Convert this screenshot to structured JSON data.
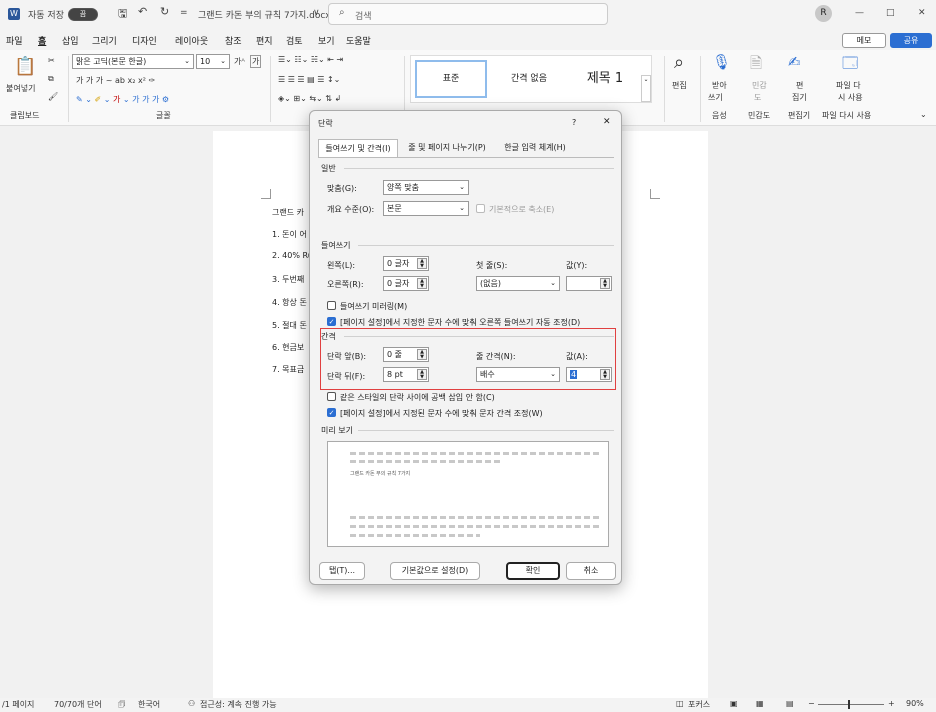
{
  "titlebar": {
    "autosave": "자동 저장",
    "toggle": "끔",
    "filename": "그랜드 카돈 부의 규칙 7가지.docx",
    "filename_chevron": "∨",
    "search": "검색",
    "avatar": "R"
  },
  "menu": [
    "파일",
    "홈",
    "삽입",
    "그리기",
    "디자인",
    "레이아웃",
    "참조",
    "편지",
    "검토",
    "보기",
    "도움말"
  ],
  "top_buttons": {
    "memo": "메모",
    "share": "공유"
  },
  "ribbon": {
    "paste": "붙여넣기",
    "clipboard": "클립보드",
    "font_name": "맑은 고딕(본문 한글)",
    "font_size": "10",
    "font_group": "글꼴",
    "styles": {
      "normal": "표준",
      "nospacing": "간격 없음",
      "heading1": "제목 1"
    },
    "edit": "편집",
    "dictate1": "받아",
    "dictate2": "쓰기",
    "voice": "음성",
    "sensitivity1": "민감",
    "sensitivity2": "도",
    "sensitivity": "민감도",
    "editor1": "편",
    "editor2": "집기",
    "editor": "편집기",
    "reuse1": "파일 다",
    "reuse2": "시 사용",
    "reuse": "파일 다시 사용"
  },
  "doc": {
    "title": "그랜드 카",
    "items": [
      "1. 돈이 어",
      "2. 40% Ru",
      "3. 두번째",
      "4. 항상 돈",
      "5. 절대 돈",
      "6. 현금보",
      "7. 목표금"
    ]
  },
  "status": {
    "page": "/1 페이지",
    "words": "70/70개 단어",
    "lang": "한국어",
    "access": "접근성: 계속 진행 가능",
    "focus": "포커스",
    "zoom": "90%"
  },
  "dialog": {
    "title": "단락",
    "help": "?",
    "close": "✕",
    "tabs": [
      "들여쓰기 및 간격(I)",
      "줄 및 페이지 나누기(P)",
      "한글 입력 체계(H)"
    ],
    "general": "일반",
    "alignment_label": "맞춤(G):",
    "alignment_value": "양쪽 맞춤",
    "outline_label": "개요 수준(O):",
    "outline_value": "본문",
    "collapse_label": "기본적으로 축소(E)",
    "indent": "들여쓰기",
    "left_label": "왼쪽(L):",
    "left_value": "0 글자",
    "right_label": "오른쪽(R):",
    "right_value": "0 글자",
    "first_label": "첫 줄(S):",
    "first_value": "(없음)",
    "by_label": "값(Y):",
    "by_value": "",
    "mirror_label": "들여쓰기 미러링(M)",
    "auto_right_label": "[페이지 설정]에서 지정한 문자 수에 맞춰 오른쪽 들여쓰기 자동 조정(D)",
    "spacing": "간격",
    "before_label": "단락 앞(B):",
    "before_value": "0 줄",
    "after_label": "단락 뒤(F):",
    "after_value": "8 pt",
    "linespacing_label": "줄 간격(N):",
    "linespacing_value": "배수",
    "at_label": "값(A):",
    "at_value": "4",
    "nospace_label": "같은 스타일의 단락 사이에 공백 삽입 안 함(C)",
    "snap_label": "[페이지 설정]에서 지정된 문자 수에 맞춰 문자 간격 조정(W)",
    "preview": "미리 보기",
    "preview_text": "그랜드 카돈 부의 규칙 7가지",
    "tabs_btn": "탭(T)...",
    "default_btn": "기본값으로 설정(D)",
    "ok_btn": "확인",
    "cancel_btn": "취소"
  },
  "colors": {
    "accent": "#2b6ed2",
    "highlight": "#e04040"
  }
}
